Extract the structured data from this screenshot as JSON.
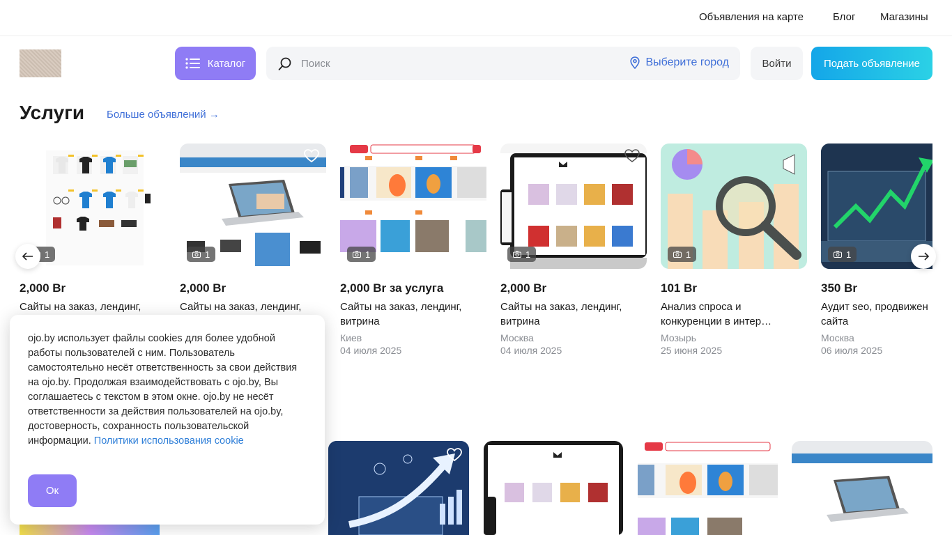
{
  "top_nav": {
    "map_link": "Объявления на карте",
    "blog_link": "Блог",
    "shops_link": "Магазины"
  },
  "header": {
    "catalog_label": "Каталог",
    "search_placeholder": "Поиск",
    "city_label": "Выберите город",
    "login_label": "Войти",
    "post_ad_label": "Подать объявление"
  },
  "section": {
    "title": "Услуги",
    "more_link": "Больше объявлений →"
  },
  "cards": [
    {
      "price": "2,000 Br",
      "title_line1": "Сайты на заказ, лендинг,",
      "title_line2": "",
      "city": "",
      "date": "",
      "photos": "1"
    },
    {
      "price": "2,000 Br",
      "title_line1": "Сайты на заказ, лендинг,",
      "title_line2": "",
      "city": "",
      "date": "",
      "photos": "1"
    },
    {
      "price": "2,000 Br за услуга",
      "title_line1": "Сайты на заказ, лендинг,",
      "title_line2": "витрина",
      "city": "Киев",
      "date": "04 июля 2025",
      "photos": "1"
    },
    {
      "price": "2,000 Br",
      "title_line1": "Сайты на заказ, лендинг,",
      "title_line2": "витрина",
      "city": "Москва",
      "date": "04 июля 2025",
      "photos": "1"
    },
    {
      "price": "101 Br",
      "title_line1": "Анализ спроса и",
      "title_line2": "конкуренции в интер…",
      "city": "Мозырь",
      "date": "25 июня 2025",
      "photos": "1"
    },
    {
      "price": "350 Br",
      "title_line1": "Аудит seo, продвижен",
      "title_line2": "сайта",
      "city": "Москва",
      "date": "06 июля 2025",
      "photos": "1"
    }
  ],
  "cookie": {
    "text": "ojo.by использует файлы cookies для более удобной работы пользователей с ним. Пользователь самостоятельно несёт ответственность за свои действия на ojo.by. Продолжая взаимодействовать с ojo.by, Вы соглашаетесь с текстом в этом окне. ojo.by не несёт ответственности за действия пользователей на ojo.by, достоверность, сохранность пользовательской информации.",
    "link_text": "Политики использования cookie",
    "ok_label": "Ок"
  },
  "colors": {
    "accent_purple": "#8f7cf5",
    "link_blue": "#3f6fd8",
    "cta_gradient_start": "#14a6e8",
    "cta_gradient_end": "#2bd1e6"
  }
}
